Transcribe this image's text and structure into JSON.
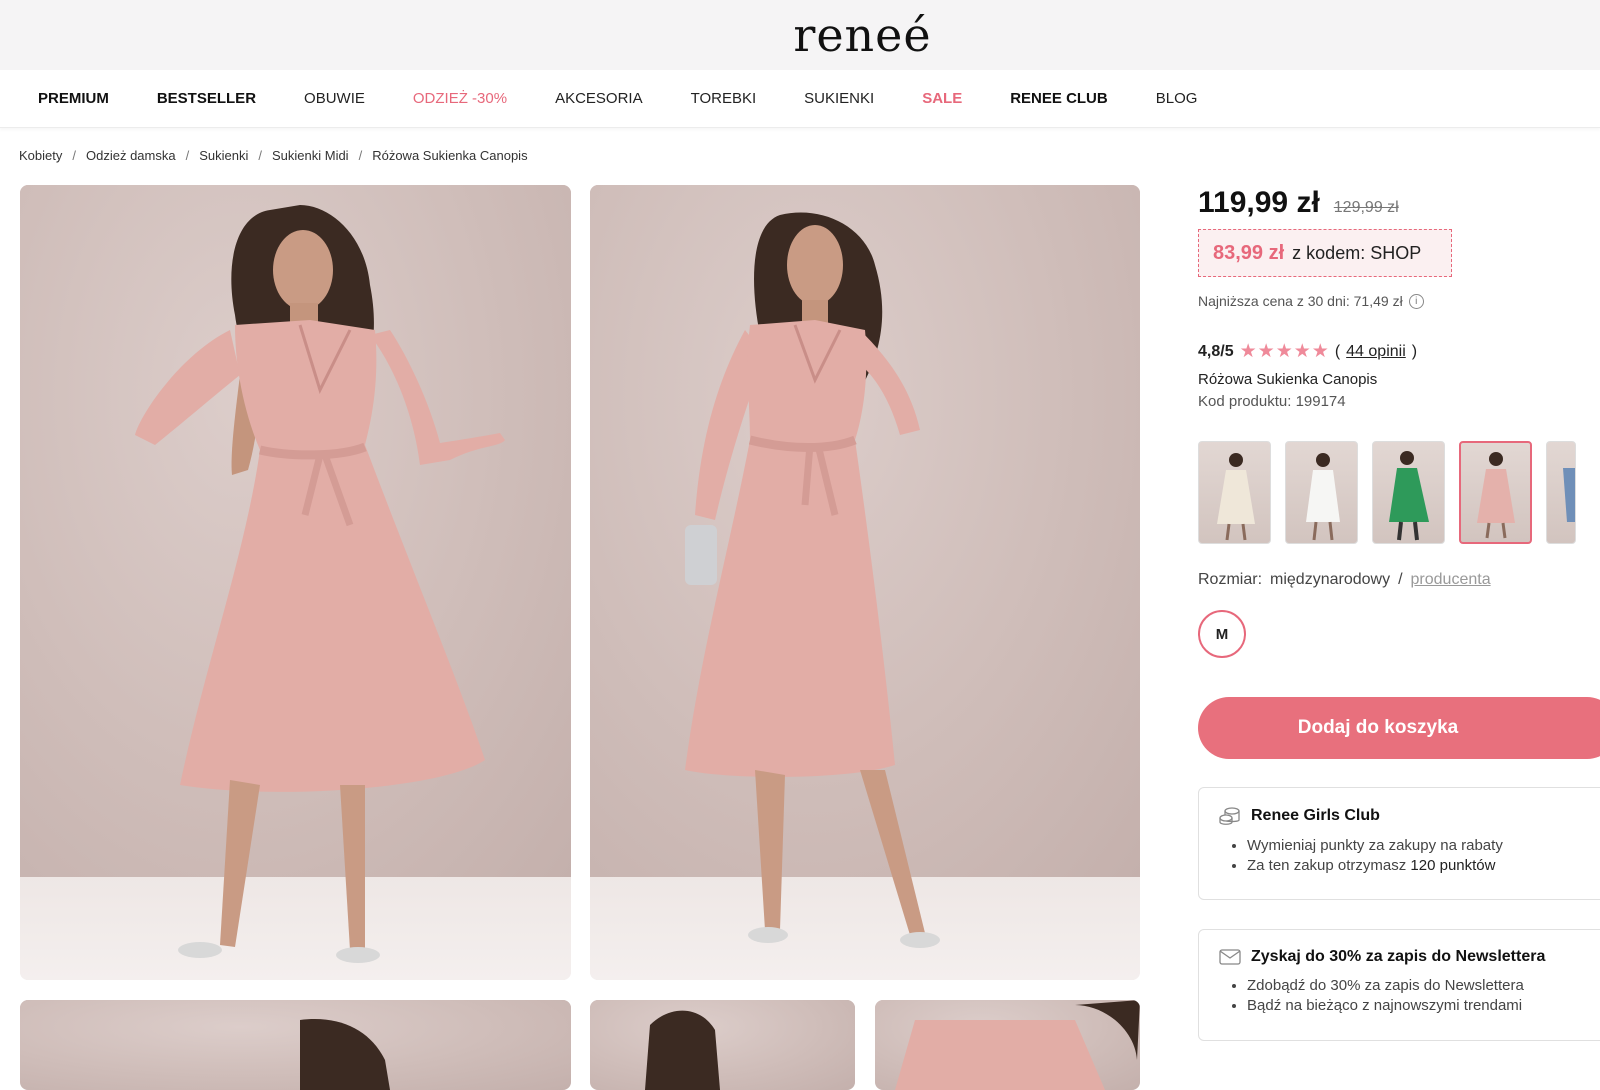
{
  "brand": {
    "logo_text": "reneé"
  },
  "nav": {
    "items": [
      {
        "label": "PREMIUM"
      },
      {
        "label": "BESTSELLER"
      },
      {
        "label": "OBUWIE"
      },
      {
        "label": "ODZIEŻ -30%"
      },
      {
        "label": "AKCESORIA"
      },
      {
        "label": "TOREBKI"
      },
      {
        "label": "SUKIENKI"
      },
      {
        "label": "SALE"
      },
      {
        "label": "RENEE CLUB"
      },
      {
        "label": "BLOG"
      }
    ]
  },
  "breadcrumb": [
    "Kobiety",
    "Odzież damska",
    "Sukienki",
    "Sukienki Midi",
    "Różowa Sukienka Canopis"
  ],
  "product": {
    "price": "119,99 zł",
    "old_price": "129,99 zł",
    "promo_price": "83,99 zł",
    "promo_code_text": "z kodem: SHOP",
    "lowest_price_text": "Najniższa cena z 30 dni: 71,49 zł",
    "rating": "4,8/5",
    "stars": 5,
    "reviews_open": "(",
    "reviews_link": "44 opinii",
    "reviews_close": ")",
    "name": "Różowa Sukienka Canopis",
    "code": "Kod produktu: 199174",
    "size_label": "Rozmiar:",
    "size_system": "międzynarodowy",
    "size_sep": "/",
    "size_alt": "producenta",
    "size_value": "M",
    "add_to_cart": "Dodaj do koszyka"
  },
  "color_variants": [
    {
      "name": "cream",
      "color": "#efe7d9"
    },
    {
      "name": "white",
      "color": "#f6f6f4"
    },
    {
      "name": "green",
      "color": "#2e9a5a"
    },
    {
      "name": "pink",
      "color": "#e4b1ab"
    },
    {
      "name": "blue",
      "color": "#6f8fb8"
    }
  ],
  "club_card": {
    "title": "Renee Girls Club",
    "items": [
      "Wymieniaj punkty za zakupy na rabaty"
    ],
    "points_prefix": "Za ten zakup otrzymasz",
    "points_value": "120 punktów"
  },
  "newsletter_card": {
    "title": "Zyskaj do 30% za zapis do Newslettera",
    "items": [
      "Zdobądź do 30% za zapis do Newslettera",
      "Bądź na bieżąco z najnowszymi trendami"
    ]
  },
  "colors": {
    "accent": "#e7687b",
    "button": "#e8707d",
    "dress": "#e2ada6"
  }
}
